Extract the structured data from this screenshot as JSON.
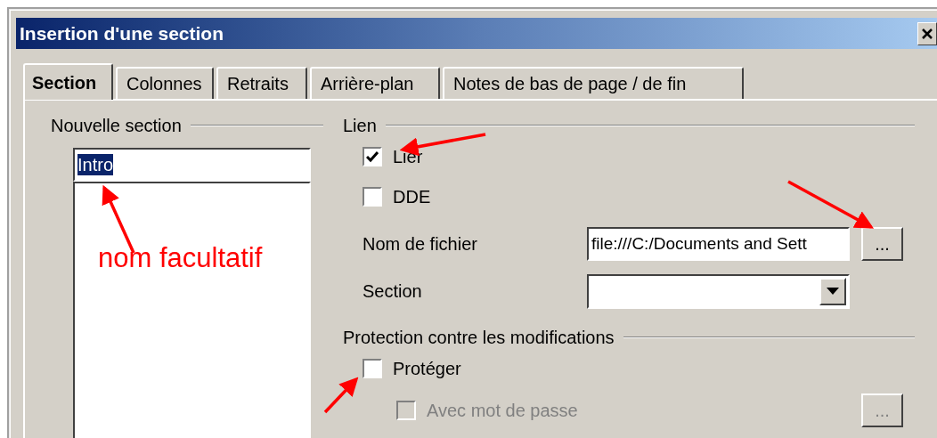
{
  "window": {
    "title": "Insertion d'une section"
  },
  "tabs": [
    {
      "label": "Section",
      "selected": true
    },
    {
      "label": "Colonnes",
      "selected": false
    },
    {
      "label": "Retraits",
      "selected": false
    },
    {
      "label": "Arrière-plan",
      "selected": false
    },
    {
      "label": "Notes de bas de page / de fin",
      "selected": false
    }
  ],
  "new_section": {
    "heading": "Nouvelle section",
    "name_value": "Intro",
    "name_text_selected": true
  },
  "link": {
    "heading": "Lien",
    "options": [
      {
        "label": "Lier",
        "checked": true
      },
      {
        "label": "DDE",
        "checked": false
      }
    ],
    "file_name": {
      "label": "Nom de fichier",
      "value": "file:///C:/Documents and Sett",
      "browse_button": "..."
    },
    "section": {
      "label": "Section"
    }
  },
  "protection": {
    "heading": "Protection contre les modifications",
    "protect": {
      "label": "Protéger",
      "checked": false,
      "disabled": false
    },
    "password": {
      "label": "Avec mot de passe",
      "checked": false,
      "disabled": true,
      "button": "...",
      "button_disabled": true
    }
  },
  "annotation": {
    "note": "nom facultatif"
  }
}
